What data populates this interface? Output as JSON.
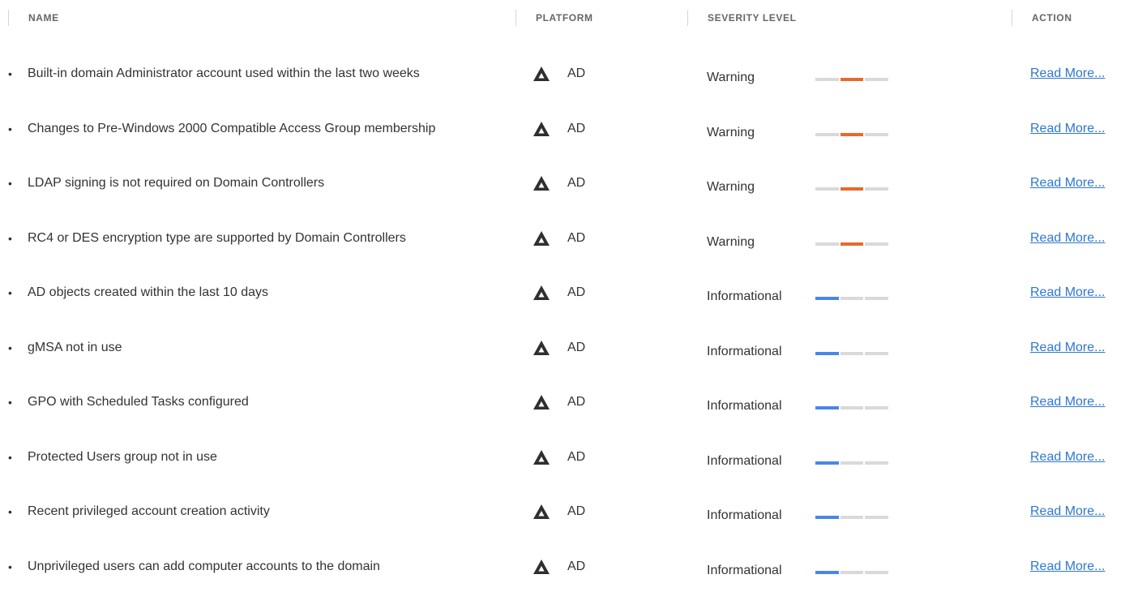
{
  "columns": {
    "name": "NAME",
    "platform": "PLATFORM",
    "severity": "SEVERITY LEVEL",
    "action": "ACTION"
  },
  "colors": {
    "warning": "#e8692c",
    "informational": "#4a86e8",
    "inactive": "#d9d9d9",
    "link": "#2e77d0"
  },
  "platform_icon": "triangle-logo-icon",
  "rows": [
    {
      "name": "Built-in domain Administrator account used within the last two weeks",
      "platform": "AD",
      "severity": "Warning",
      "level": 2,
      "action": "Read More..."
    },
    {
      "name": "Changes to Pre-Windows 2000 Compatible Access Group membership",
      "platform": "AD",
      "severity": "Warning",
      "level": 2,
      "action": "Read More..."
    },
    {
      "name": "LDAP signing is not required on Domain Controllers",
      "platform": "AD",
      "severity": "Warning",
      "level": 2,
      "action": "Read More..."
    },
    {
      "name": "RC4 or DES encryption type are supported by Domain Controllers",
      "platform": "AD",
      "severity": "Warning",
      "level": 2,
      "action": "Read More..."
    },
    {
      "name": "AD objects created within the last 10 days",
      "platform": "AD",
      "severity": "Informational",
      "level": 1,
      "action": "Read More..."
    },
    {
      "name": "gMSA not in use",
      "platform": "AD",
      "severity": "Informational",
      "level": 1,
      "action": "Read More..."
    },
    {
      "name": "GPO with Scheduled Tasks configured",
      "platform": "AD",
      "severity": "Informational",
      "level": 1,
      "action": "Read More..."
    },
    {
      "name": "Protected Users group not in use",
      "platform": "AD",
      "severity": "Informational",
      "level": 1,
      "action": "Read More..."
    },
    {
      "name": "Recent privileged account creation activity",
      "platform": "AD",
      "severity": "Informational",
      "level": 1,
      "action": "Read More..."
    },
    {
      "name": "Unprivileged users can add computer accounts to the domain",
      "platform": "AD",
      "severity": "Informational",
      "level": 1,
      "action": "Read More..."
    }
  ]
}
